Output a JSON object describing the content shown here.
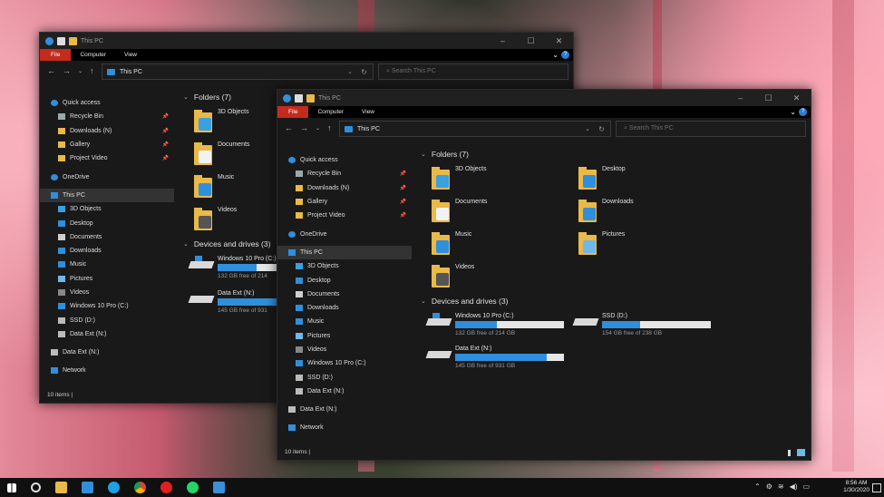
{
  "window_title": "This PC",
  "ribbon_tabs": [
    "File",
    "Computer",
    "View"
  ],
  "address_crumb": "This PC",
  "search_placeholder": "Search This PC",
  "sidebar": [
    {
      "label": "Quick access",
      "icon": "star-icon",
      "level": 0
    },
    {
      "label": "Recycle Bin",
      "icon": "recycle-bin-icon",
      "level": 1,
      "pinned": true
    },
    {
      "label": "Downloads (N)",
      "icon": "folder-icon",
      "level": 1,
      "pinned": true
    },
    {
      "label": "Gallery",
      "icon": "folder-icon",
      "level": 1,
      "pinned": true
    },
    {
      "label": "Project Video",
      "icon": "folder-icon",
      "level": 1,
      "pinned": true
    },
    {
      "label": "OneDrive",
      "icon": "cloud-icon",
      "level": 0,
      "gap": true
    },
    {
      "label": "This PC",
      "icon": "pc-icon",
      "level": 0,
      "selected": true,
      "gap": true
    },
    {
      "label": "3D Objects",
      "icon": "3d-objects-icon",
      "level": 1
    },
    {
      "label": "Desktop",
      "icon": "desktop-icon",
      "level": 1
    },
    {
      "label": "Documents",
      "icon": "documents-icon",
      "level": 1
    },
    {
      "label": "Downloads",
      "icon": "download-icon",
      "level": 1
    },
    {
      "label": "Music",
      "icon": "music-icon",
      "level": 1
    },
    {
      "label": "Pictures",
      "icon": "pictures-icon",
      "level": 1
    },
    {
      "label": "Videos",
      "icon": "videos-icon",
      "level": 1
    },
    {
      "label": "Windows 10 Pro (C:)",
      "icon": "windows-drive-icon",
      "level": 1
    },
    {
      "label": "SSD (D:)",
      "icon": "drive-icon",
      "level": 1
    },
    {
      "label": "Data Ext (N:)",
      "icon": "drive-icon",
      "level": 1
    },
    {
      "label": "Data Ext (N:)",
      "icon": "drive-icon",
      "level": 0,
      "gap": true
    },
    {
      "label": "Network",
      "icon": "network-icon",
      "level": 0,
      "gap": true
    }
  ],
  "folders_header": "Folders (7)",
  "folders": [
    {
      "label": "3D Objects",
      "icon": "3d-objects-folder-icon",
      "color": "#3aa0e0"
    },
    {
      "label": "Desktop",
      "icon": "desktop-folder-icon",
      "color": "#2f8fdc"
    },
    {
      "label": "Documents",
      "icon": "documents-folder-icon",
      "color": "#f2f2f2"
    },
    {
      "label": "Downloads",
      "icon": "downloads-folder-icon",
      "color": "#2f8fdc"
    },
    {
      "label": "Music",
      "icon": "music-folder-icon",
      "color": "#2f8fdc"
    },
    {
      "label": "Pictures",
      "icon": "pictures-folder-icon",
      "color": "#6fb8e8"
    },
    {
      "label": "Videos",
      "icon": "videos-folder-icon",
      "color": "#555"
    }
  ],
  "drives_header": "Devices and drives (3)",
  "drives": [
    {
      "label": "Windows 10 Pro (C:)",
      "detail": "132 GB free of 214 GB",
      "used": 0.38,
      "windows": true
    },
    {
      "label": "SSD (D:)",
      "detail": "154 GB free of 238 GB",
      "used": 0.35,
      "windows": false
    },
    {
      "label": "Data Ext (N:)",
      "detail": "145 GB free of 931 GB",
      "used": 0.84,
      "windows": false
    }
  ],
  "back_window": {
    "drive_c_label": "Windows 10 Pro (C:)",
    "drive_c_detail": "132 GB free of 214",
    "drive_n_label": "Data Ext (N:)",
    "drive_n_detail": "145 GB free of 931"
  },
  "status_text": "10 items",
  "clock": {
    "time": "8:56 AM",
    "date": "1/30/2020"
  },
  "colors": {
    "accent": "#2f8fdc",
    "file_tab": "#c42b1c",
    "folder": "#e9b949"
  }
}
